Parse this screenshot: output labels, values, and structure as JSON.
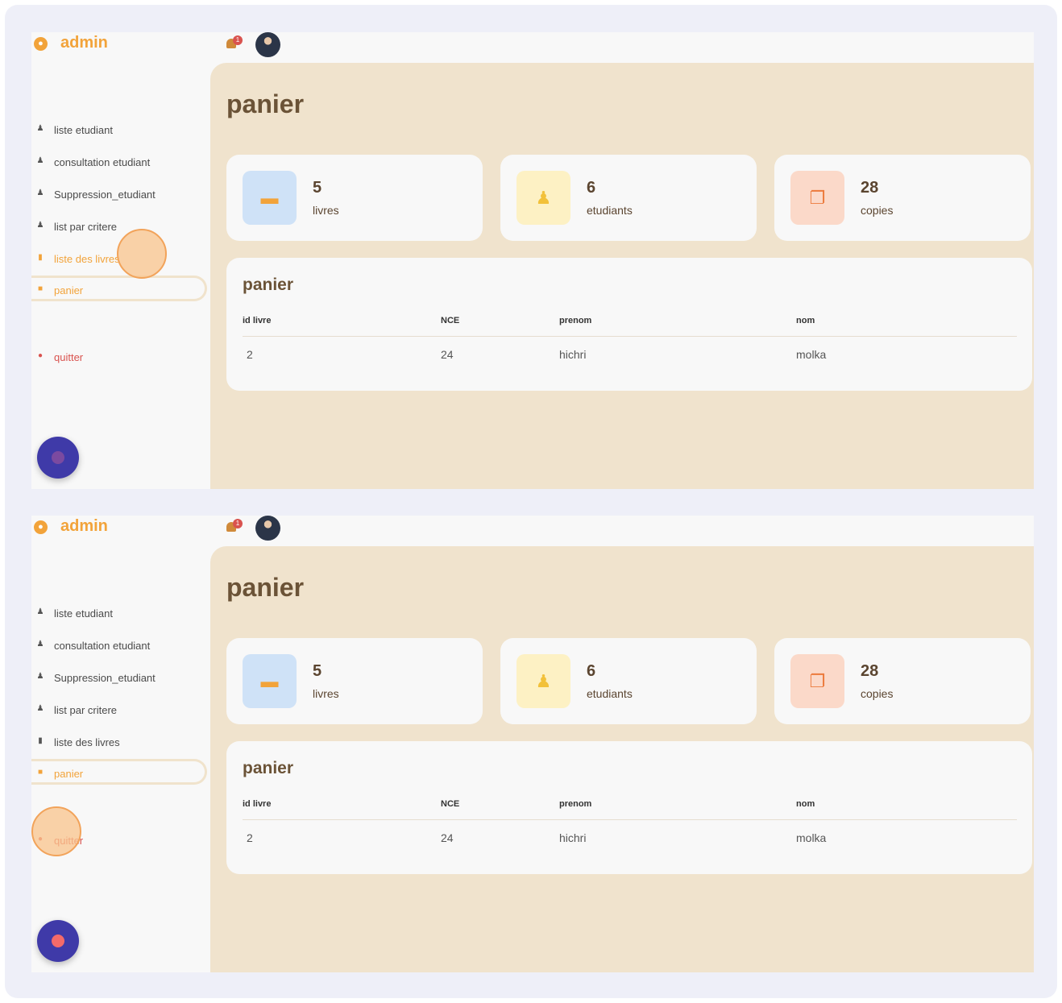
{
  "frames": [
    {
      "brand": {
        "title": "admin"
      },
      "notifications": {
        "count": "1"
      },
      "sidebar": {
        "items": [
          {
            "label": "liste etudiant",
            "icon": "users-icon"
          },
          {
            "label": "consultation etudiant",
            "icon": "user-check-icon"
          },
          {
            "label": "Suppression_etudiant",
            "icon": "user-remove-icon"
          },
          {
            "label": "list par critere",
            "icon": "people-icon"
          },
          {
            "label": "liste des livres",
            "icon": "books-icon"
          },
          {
            "label": "panier",
            "icon": "bag-icon"
          },
          {
            "label": "quitter",
            "icon": "exit-icon"
          }
        ]
      },
      "main": {
        "title": "panier",
        "cards": [
          {
            "value": "5",
            "label": "livres",
            "icon": "book-icon"
          },
          {
            "value": "6",
            "label": "etudiants",
            "icon": "users-icon"
          },
          {
            "value": "28",
            "label": "copies",
            "icon": "copies-icon"
          }
        ],
        "table": {
          "title": "panier",
          "headers": [
            "id livre",
            "NCE",
            "prenom",
            "nom"
          ],
          "rows": [
            [
              "2",
              "24",
              "hichri",
              "molka"
            ]
          ]
        }
      }
    },
    {
      "brand": {
        "title": "admin"
      },
      "notifications": {
        "count": "1"
      },
      "sidebar": {
        "items": [
          {
            "label": "liste etudiant",
            "icon": "users-icon"
          },
          {
            "label": "consultation etudiant",
            "icon": "user-check-icon"
          },
          {
            "label": "Suppression_etudiant",
            "icon": "user-remove-icon"
          },
          {
            "label": "list par critere",
            "icon": "people-icon"
          },
          {
            "label": "liste des livres",
            "icon": "books-icon"
          },
          {
            "label": "panier",
            "icon": "bag-icon"
          },
          {
            "label": "quitter",
            "icon": "exit-icon"
          }
        ]
      },
      "main": {
        "title": "panier",
        "cards": [
          {
            "value": "5",
            "label": "livres",
            "icon": "book-icon"
          },
          {
            "value": "6",
            "label": "etudiants",
            "icon": "users-icon"
          },
          {
            "value": "28",
            "label": "copies",
            "icon": "copies-icon"
          }
        ],
        "table": {
          "title": "panier",
          "headers": [
            "id livre",
            "NCE",
            "prenom",
            "nom"
          ],
          "rows": [
            [
              "2",
              "24",
              "hichri",
              "molka"
            ]
          ]
        }
      }
    }
  ],
  "colors": {
    "accent": "#f2a33a",
    "main_bg": "#f0e3cd",
    "fab": "#3f3aa8",
    "danger": "#d9534f"
  }
}
